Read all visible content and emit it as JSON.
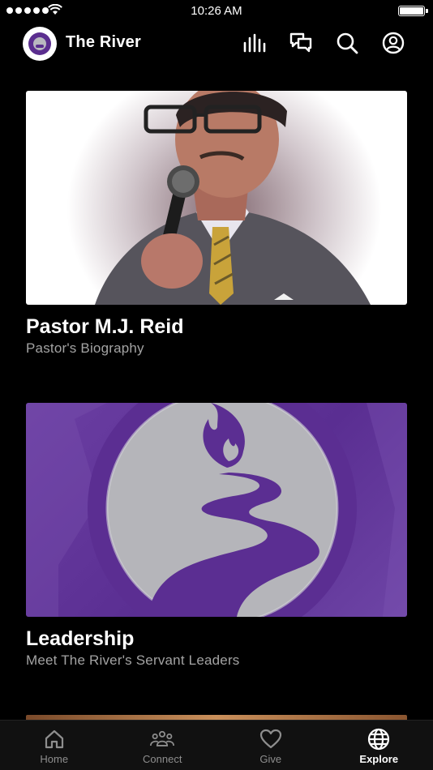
{
  "status_bar": {
    "time": "10:26 AM"
  },
  "header": {
    "app_title": "The River",
    "icons": [
      "logo",
      "audio-icon",
      "chat-icon",
      "search-icon",
      "account-icon"
    ]
  },
  "cards": [
    {
      "title": "Pastor M.J. Reid",
      "subtitle": "Pastor's Biography",
      "image": "pastor-photo"
    },
    {
      "title": "Leadership",
      "subtitle": "Meet The River's Servant Leaders",
      "image": "river-logo-graphic"
    }
  ],
  "tab_bar": {
    "tabs": [
      {
        "label": "Home",
        "icon": "home-icon"
      },
      {
        "label": "Connect",
        "icon": "people-icon"
      },
      {
        "label": "Give",
        "icon": "heart-icon"
      },
      {
        "label": "Explore",
        "icon": "globe-icon"
      }
    ],
    "active": "Explore"
  },
  "colors": {
    "background": "#000000",
    "brand_purple": "#5b2e8f",
    "subtitle_gray": "#a3a3a3",
    "tab_inactive": "#8e8e8e",
    "tab_active": "#ffffff"
  }
}
